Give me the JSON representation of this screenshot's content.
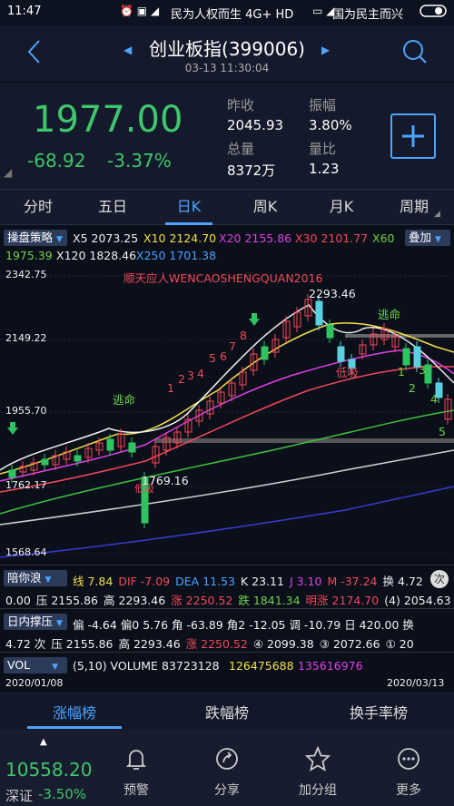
{
  "status": {
    "time": "11:47",
    "carrier": "民为人权而生 4G+ HD",
    "right_text": "国为民主而兴"
  },
  "nav": {
    "title": "创业板指(399006)",
    "subtitle": "03-13 11:30:04"
  },
  "quote": {
    "price": "1977.00",
    "change": "-68.92",
    "change_pct": "-3.37%",
    "labels": {
      "prev": "昨收",
      "amp": "振幅",
      "vol": "总量",
      "ratio": "量比"
    },
    "values": {
      "prev": "2045.93",
      "amp": "3.80%",
      "vol": "8372万",
      "ratio": "1.23"
    }
  },
  "tabs": [
    "分时",
    "五日",
    "日K",
    "周K",
    "月K",
    "周期"
  ],
  "ma": {
    "btn": "操盘策略",
    "x5": "X5 2073.25",
    "x10": "X10 2124.70",
    "x20": "X20 2155.86",
    "x30": "X30 2101.77",
    "x60": "X60",
    "x60v": "1975.39",
    "x120": "X120 1828.46",
    "x250": "X250 1701.38",
    "overlay_btn": "叠加"
  },
  "chart": {
    "y_labels": [
      "2342.75",
      "2149.22",
      "1955.70",
      "1762.17",
      "1568.64"
    ],
    "watermark": "顺天应人WENCAOSHENGQUAN2016",
    "hi_label": "2293.46",
    "lo_label": "1769.16",
    "marks": [
      "逃命",
      "逃命",
      "低吸",
      "低吸",
      "1",
      "2",
      "3",
      "4",
      "5",
      "6",
      "7",
      "8",
      "1",
      "2",
      "3",
      "4",
      "5"
    ]
  },
  "ind1": {
    "btn": "陪你浪",
    "line1": [
      [
        "线 7.84",
        "y"
      ],
      [
        "DIF -7.09",
        "r"
      ],
      [
        "DEA 11.53",
        "b"
      ],
      [
        "K 23.11",
        "w"
      ],
      [
        "J 3.10",
        "m"
      ],
      [
        "M -37.24",
        "r"
      ],
      [
        "换 4.72",
        "w"
      ]
    ],
    "line2": [
      [
        "0.00",
        "w"
      ],
      [
        "压 2155.86",
        "w"
      ],
      [
        "高 2293.46",
        "w"
      ],
      [
        "涨 2250.52",
        "r"
      ],
      [
        "跌 1841.34",
        "gr"
      ],
      [
        "明涨 2174.70",
        "r"
      ],
      [
        "(4) 2054.63",
        "w"
      ]
    ]
  },
  "ind2": {
    "btn": "日内撑压",
    "line1": "偏 -4.64 偏0 5.76 角 -63.89 角2 -12.05 调 -10.79 日 420.00 换",
    "line2": [
      [
        "4.72 次",
        "w"
      ],
      [
        "压 2155.86",
        "w"
      ],
      [
        "高 2293.46",
        "w"
      ],
      [
        "涨 2250.52",
        "r"
      ],
      [
        "④ 2099.38",
        "w"
      ],
      [
        "③ 2072.66",
        "w"
      ],
      [
        "① 20",
        "w"
      ]
    ]
  },
  "vol": {
    "btn": "VOL",
    "params": "(5,10) VOLUME",
    "v1": "83723128",
    "v2": "126475688",
    "v3": "135616976"
  },
  "dates": {
    "start": "2020/01/08",
    "end": "2020/03/13"
  },
  "bottom_tabs": [
    "涨幅榜",
    "跌幅榜",
    "换手率榜"
  ],
  "footer": {
    "index_value": "10558.20",
    "index_name": "深证",
    "index_pct": "-3.50%",
    "items": [
      "预警",
      "分享",
      "加分组",
      "更多"
    ]
  },
  "chart_data": {
    "type": "candlestick",
    "ylim": [
      1568.64,
      2342.75
    ],
    "y_ticks": [
      2342.75,
      2149.22,
      1955.7,
      1762.17,
      1568.64
    ],
    "high": 2293.46,
    "low": 1769.16,
    "last": 1977.0
  }
}
